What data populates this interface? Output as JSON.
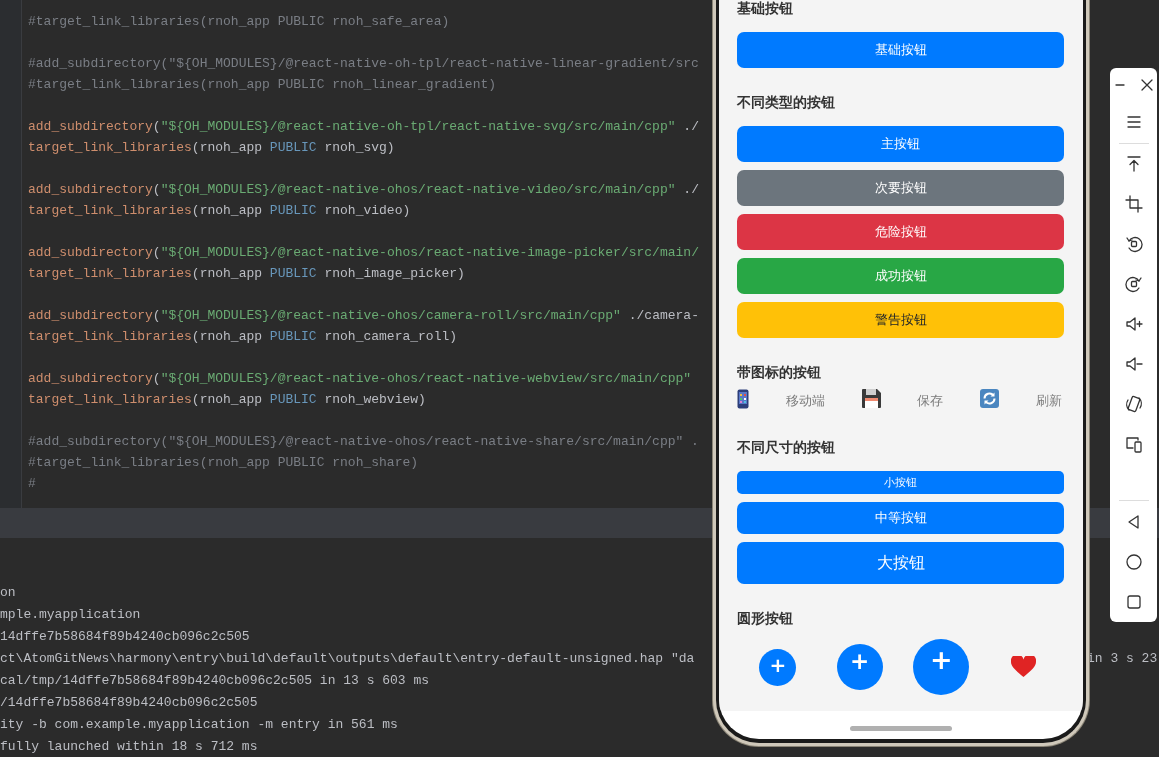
{
  "editor": {
    "lines": [
      {
        "kind": "code",
        "segments": [
          {
            "kind": "comment",
            "text": "#target_link_libraries(rnoh_app PUBLIC rnoh_safe_area)"
          }
        ]
      },
      {
        "kind": "blank"
      },
      {
        "kind": "code",
        "segments": [
          {
            "kind": "comment",
            "text": "#add_subdirectory(\"${OH_MODULES}/@react-native-oh-tpl/react-native-linear-gradient/src"
          }
        ]
      },
      {
        "kind": "code",
        "segments": [
          {
            "kind": "comment",
            "text": "#target_link_libraries(rnoh_app PUBLIC rnoh_linear_gradient)"
          }
        ]
      },
      {
        "kind": "blank"
      },
      {
        "kind": "code",
        "segments": [
          {
            "kind": "func",
            "text": "add_subdirectory"
          },
          {
            "kind": "plain",
            "text": "("
          },
          {
            "kind": "string",
            "text": "\"${OH_MODULES}/@react-native-oh-tpl/react-native-svg/src/main/cpp\""
          },
          {
            "kind": "plain",
            "text": " ./"
          }
        ]
      },
      {
        "kind": "code",
        "segments": [
          {
            "kind": "func",
            "text": "target_link_libraries"
          },
          {
            "kind": "plain",
            "text": "(rnoh_app "
          },
          {
            "kind": "keyword",
            "text": "PUBLIC"
          },
          {
            "kind": "plain",
            "text": " rnoh_svg)"
          }
        ]
      },
      {
        "kind": "blank"
      },
      {
        "kind": "code",
        "segments": [
          {
            "kind": "func",
            "text": "add_subdirectory"
          },
          {
            "kind": "plain",
            "text": "("
          },
          {
            "kind": "string",
            "text": "\"${OH_MODULES}/@react-native-ohos/react-native-video/src/main/cpp\""
          },
          {
            "kind": "plain",
            "text": " ./"
          }
        ]
      },
      {
        "kind": "code",
        "segments": [
          {
            "kind": "func",
            "text": "target_link_libraries"
          },
          {
            "kind": "plain",
            "text": "(rnoh_app "
          },
          {
            "kind": "keyword",
            "text": "PUBLIC"
          },
          {
            "kind": "plain",
            "text": " rnoh_video)"
          }
        ]
      },
      {
        "kind": "blank"
      },
      {
        "kind": "code",
        "segments": [
          {
            "kind": "func",
            "text": "add_subdirectory"
          },
          {
            "kind": "plain",
            "text": "("
          },
          {
            "kind": "string",
            "text": "\"${OH_MODULES}/@react-native-ohos/react-native-image-picker/src/main/"
          }
        ]
      },
      {
        "kind": "code",
        "segments": [
          {
            "kind": "func",
            "text": "target_link_libraries"
          },
          {
            "kind": "plain",
            "text": "(rnoh_app "
          },
          {
            "kind": "keyword",
            "text": "PUBLIC"
          },
          {
            "kind": "plain",
            "text": " rnoh_image_picker)"
          }
        ]
      },
      {
        "kind": "blank"
      },
      {
        "kind": "code",
        "segments": [
          {
            "kind": "func",
            "text": "add_subdirectory"
          },
          {
            "kind": "plain",
            "text": "("
          },
          {
            "kind": "string",
            "text": "\"${OH_MODULES}/@react-native-ohos/camera-roll/src/main/cpp\""
          },
          {
            "kind": "plain",
            "text": " ./camera-"
          }
        ]
      },
      {
        "kind": "code",
        "segments": [
          {
            "kind": "func",
            "text": "target_link_libraries"
          },
          {
            "kind": "plain",
            "text": "(rnoh_app "
          },
          {
            "kind": "keyword",
            "text": "PUBLIC"
          },
          {
            "kind": "plain",
            "text": " rnoh_camera_roll)"
          }
        ]
      },
      {
        "kind": "blank"
      },
      {
        "kind": "code",
        "segments": [
          {
            "kind": "func",
            "text": "add_subdirectory"
          },
          {
            "kind": "plain",
            "text": "("
          },
          {
            "kind": "string",
            "text": "\"${OH_MODULES}/@react-native-ohos/react-native-webview/src/main/cpp\""
          }
        ]
      },
      {
        "kind": "code",
        "segments": [
          {
            "kind": "func",
            "text": "target_link_libraries"
          },
          {
            "kind": "plain",
            "text": "(rnoh_app "
          },
          {
            "kind": "keyword",
            "text": "PUBLIC"
          },
          {
            "kind": "plain",
            "text": " rnoh_webview)"
          }
        ]
      },
      {
        "kind": "blank"
      },
      {
        "kind": "code",
        "segments": [
          {
            "kind": "comment",
            "text": "#add_subdirectory(\"${OH_MODULES}/@react-native-ohos/react-native-share/src/main/cpp\" ."
          }
        ]
      },
      {
        "kind": "code",
        "segments": [
          {
            "kind": "comment",
            "text": "#target_link_libraries(rnoh_app PUBLIC rnoh_share)"
          }
        ]
      },
      {
        "kind": "code",
        "segments": [
          {
            "kind": "comment",
            "text": "#"
          }
        ]
      }
    ]
  },
  "console": {
    "lines": [
      {
        "text": "on"
      },
      {
        "text": "mple.myapplication"
      },
      {
        "text": "14dffe7b58684f89b4240cb096c2c505"
      },
      {
        "text": "ct\\AtomGitNews\\harmony\\entry\\build\\default\\outputs\\default\\entry-default-unsigned.hap \"da",
        "tail": "in 3 s 23"
      },
      {
        "text": "cal/tmp/14dffe7b58684f89b4240cb096c2c505 in 13 s 603 ms"
      },
      {
        "text": "/14dffe7b58684f89b4240cb096c2c505"
      },
      {
        "text": "ity -b com.example.myapplication -m entry in 561 ms"
      },
      {
        "text": "fully launched within 18 s 712 ms"
      }
    ]
  },
  "phone": {
    "sections": [
      {
        "kind": "stack",
        "title": "基础按钮",
        "buttons": [
          {
            "label": "基础按钮",
            "color": "#007aff"
          }
        ]
      },
      {
        "kind": "stack",
        "title": "不同类型的按钮",
        "buttons": [
          {
            "label": "主按钮",
            "color": "#007aff"
          },
          {
            "label": "次要按钮",
            "color": "#6c757d"
          },
          {
            "label": "危险按钮",
            "color": "#dc3545"
          },
          {
            "label": "成功按钮",
            "color": "#28a745"
          },
          {
            "label": "警告按钮",
            "color": "#ffc107"
          }
        ]
      },
      {
        "kind": "icons",
        "title": "带图标的按钮",
        "buttons": [
          {
            "kind": "phone",
            "label": "移动端"
          },
          {
            "kind": "floppy",
            "label": "保存"
          },
          {
            "kind": "refresh",
            "label": "刷新"
          }
        ]
      },
      {
        "kind": "sizes",
        "title": "不同尺寸的按钮",
        "buttons": [
          {
            "kind": "small",
            "label": "小按钮"
          },
          {
            "kind": "medium",
            "label": "中等按钮"
          },
          {
            "kind": "large",
            "label": "大按钮"
          }
        ]
      },
      {
        "kind": "circles",
        "title": "圆形按钮",
        "buttons": [
          {
            "kind": "small",
            "label": "+"
          },
          {
            "kind": "medium",
            "label": "+"
          },
          {
            "kind": "large",
            "label": "+"
          },
          {
            "kind": "heart"
          }
        ]
      }
    ]
  }
}
